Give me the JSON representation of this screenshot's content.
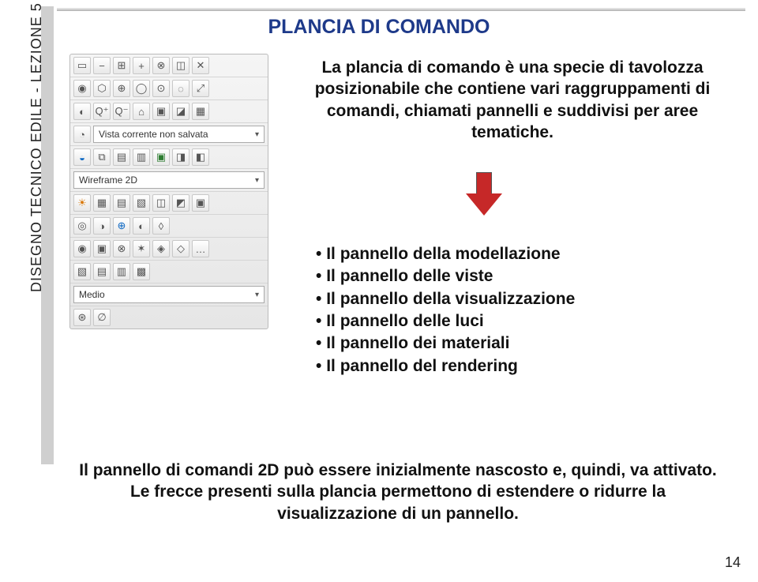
{
  "title": "PLANCIA DI COMANDO",
  "sidebar_label": "DISEGNO TECNICO EDILE - LEZIONE 5",
  "toolbar": {
    "select_view": "Vista corrente non salvata",
    "select_style": "Wireframe 2D",
    "select_quality": "Medio"
  },
  "intro": "La plancia di comando è una specie di tavolozza posizionabile che contiene vari raggruppamenti di comandi, chiamati pannelli e suddivisi per aree tematiche.",
  "bullets": [
    "Il pannello della modellazione",
    "Il pannello delle viste",
    "Il pannello della visualizzazione",
    "Il pannello delle luci",
    "Il pannello dei materiali",
    "Il pannello del rendering"
  ],
  "footer": "Il pannello di comandi 2D può essere inizialmente nascosto e, quindi, va attivato. Le frecce presenti sulla plancia permettono di estendere o ridurre la visualizzazione di un pannello.",
  "page_number": "14"
}
